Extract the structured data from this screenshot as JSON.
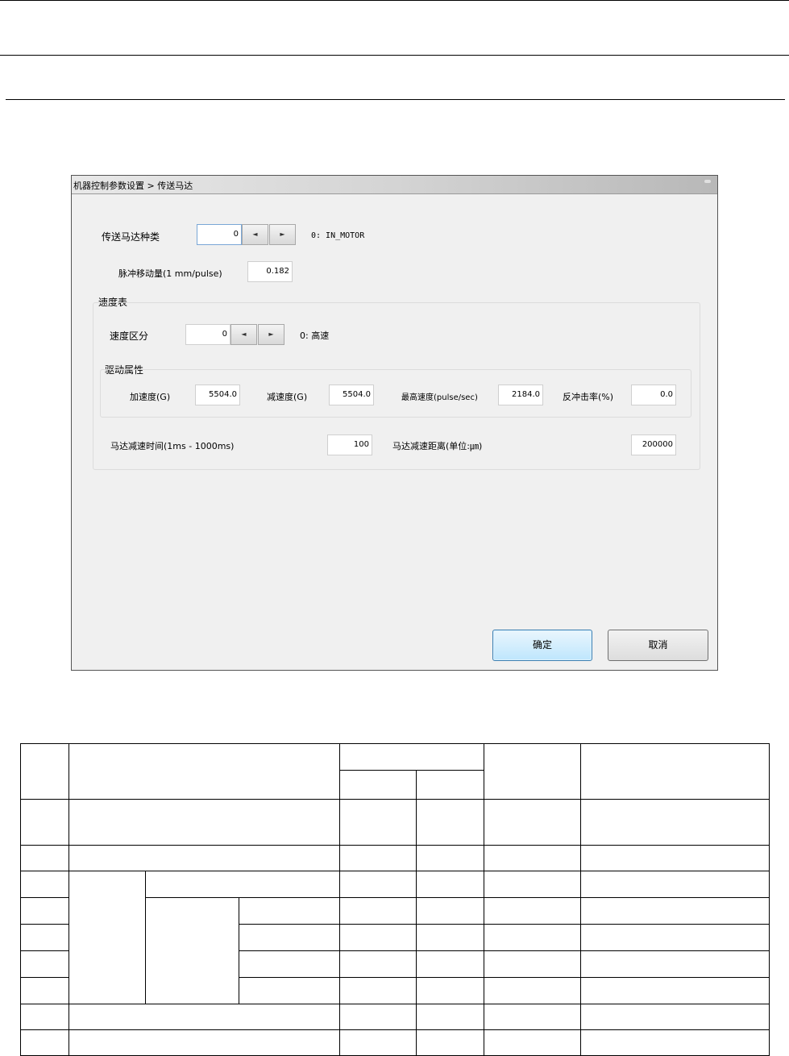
{
  "dialog": {
    "title": "机器控制参数设置 > 传送马达",
    "motor_type": {
      "label": "传送马达种类",
      "value": "0",
      "desc": "0: IN_MOTOR",
      "prev_icon": "◄",
      "next_icon": "►"
    },
    "pulse_move": {
      "label": "脉冲移动量(1 mm/pulse)",
      "value": "0.182"
    },
    "speed_table": {
      "label": "速度表",
      "speed_class": {
        "label": "速度区分",
        "value": "0",
        "desc": "0: 高速",
        "prev_icon": "◄",
        "next_icon": "►"
      },
      "drive": {
        "label": "驱动属性",
        "accel": {
          "label": "加速度(G)",
          "value": "5504.0"
        },
        "decel": {
          "label": "减速度(G)",
          "value": "5504.0"
        },
        "max_speed": {
          "label": "最高速度(pulse/sec)",
          "value": "2184.0"
        },
        "recoil": {
          "label": "反冲击率(%)",
          "value": "0.0"
        }
      },
      "decel_time": {
        "label": "马达减速时间(1ms - 1000ms)",
        "value": "100"
      },
      "decel_dist": {
        "label": "马达减速距离(单位:㎛)",
        "value": "200000"
      }
    },
    "ok_label": "确定",
    "cancel_label": "取消"
  }
}
